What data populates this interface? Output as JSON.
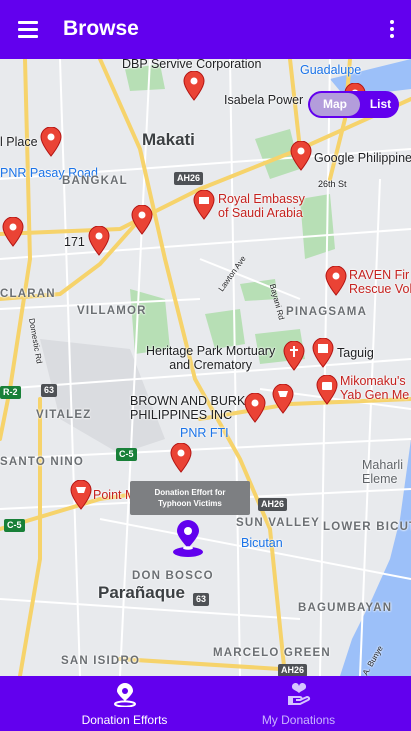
{
  "app_bar": {
    "title": "Browse",
    "menu_icon": "menu-icon",
    "more_icon": "more-vert-icon"
  },
  "view_toggle": {
    "map_label": "Map",
    "list_label": "List",
    "selected": "Map"
  },
  "map": {
    "places": {
      "dbp": "DBP Servive Corporation",
      "guadalupe": "Guadalupe",
      "isabela": "Isabela Power",
      "place": "l Place",
      "makati": "Makati",
      "google": "Google Philippine",
      "pnr_pasay": "PNR Pasay Road",
      "ah26_a": "AH26",
      "street_26th": "26th St",
      "bangkal": "BANGKAL",
      "royal_embassy": "Royal Embassy\nof Saudi Arabia",
      "n171": "171",
      "raven": "RAVEN Fir\nRescue Vol",
      "lawton": "Lawton Ave",
      "bayani": "Bayani Rd",
      "claran": "CLARAN",
      "villamor": "VILLAMOR",
      "pinagsama": "PINAGSAMA",
      "domestic": "Domestic Rd",
      "heritage": "Heritage Park Mortuary\nand Crematory",
      "taguig": "Taguig",
      "r2": "R-2",
      "n63_a": "63",
      "mikomaku": "Mikomaku's\nYab Gen Me",
      "vitalez": "VITALEZ",
      "brown": "BROWN AND BURK\nPHILIPPINES INC",
      "pnr_fti": "PNR FTI",
      "santo_nino": "SANTO NINO",
      "c5_a": "C-5",
      "maharlika": "Maharli\nEleme",
      "point": "Point M",
      "ah26_b": "AH26",
      "sun_valley": "SUN VALLEY",
      "c5_b": "C-5",
      "lower_bicutan": "LOWER BICUTA",
      "bicutan": "Bicutan",
      "don_bosco": "DON BOSCO",
      "paranaque": "Parañaque",
      "n63_b": "63",
      "bagumbayan": "BAGUMBAYAN",
      "marcelo": "MARCELO GREEN",
      "san_isidro": "SAN ISIDRO",
      "ah26_c": "AH26",
      "dr_a_bunye": "Dr. A. Bunye"
    },
    "selected_marker": {
      "tooltip": "Donation Effort for\nTyphoon Victims",
      "icon": "map-pin-icon"
    },
    "colors": {
      "water": "#9cc0f9",
      "park": "#b7dfb5",
      "road_major": "#f6d36b",
      "road_minor": "#ffffff",
      "pin_red": "#ea4335",
      "selected_pin": "#6200ee"
    }
  },
  "bottom_nav": {
    "items": [
      {
        "label": "Donation Efforts",
        "icon": "location-pin-icon",
        "active": true
      },
      {
        "label": "My Donations",
        "icon": "donation-hand-heart-icon",
        "active": false
      }
    ]
  },
  "theme": {
    "primary": "#6200ee",
    "toggle_selected": "#b39ddb"
  }
}
